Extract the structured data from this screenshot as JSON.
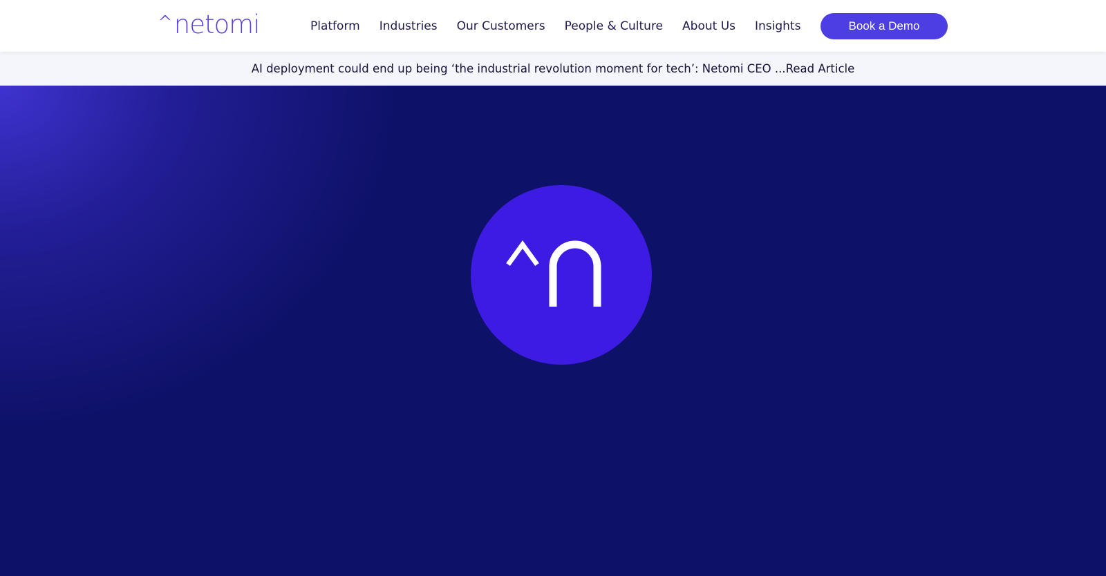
{
  "header": {
    "logo": {
      "caret": "^",
      "wordmark": "netomi"
    },
    "nav": [
      {
        "label": "Platform"
      },
      {
        "label": "Industries"
      },
      {
        "label": "Our Customers"
      },
      {
        "label": "People & Culture"
      },
      {
        "label": "About Us"
      },
      {
        "label": "Insights"
      }
    ],
    "cta_label": "Book a Demo"
  },
  "announcement": {
    "text": "AI deployment could end up being ‘the industrial revolution moment for tech’: Netomi CEO ...",
    "link_label": "Read Article"
  },
  "hero": {
    "icon": "netomi-caret-n-icon"
  },
  "colors": {
    "brand": "#4c3ee3",
    "hero_bg": "#0e1168",
    "hero_circle": "#3e1be3",
    "nav_text": "#1e1b4b",
    "announce_bg": "#f4f6fb"
  }
}
